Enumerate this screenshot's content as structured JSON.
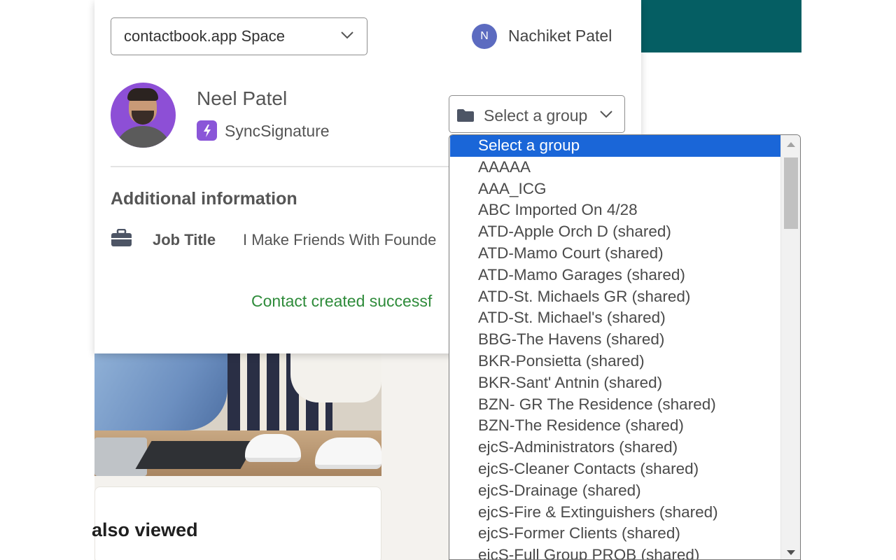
{
  "header": {
    "space_select_label": "contactbook.app Space",
    "user_initial": "N",
    "user_name": "Nachiket Patel"
  },
  "contact": {
    "name": "Neel Patel",
    "company": "SyncSignature"
  },
  "group_select": {
    "label": "Select a group"
  },
  "additional_info": {
    "title": "Additional information",
    "job_title_label": "Job Title",
    "job_title_value": "I Make Friends With Founde"
  },
  "status": {
    "message": "Contact created successf"
  },
  "background": {
    "also_viewed_title": "also viewed"
  },
  "group_options": [
    "Select a group",
    "AAAAA",
    "AAA_ICG",
    "ABC Imported On 4/28",
    "ATD-Apple Orch D (shared)",
    "ATD-Mamo Court (shared)",
    "ATD-Mamo Garages (shared)",
    "ATD-St. Michaels GR (shared)",
    "ATD-St. Michael's (shared)",
    "BBG-The Havens (shared)",
    "BKR-Ponsietta (shared)",
    "BKR-Sant' Antnin (shared)",
    "BZN- GR The Residence (shared)",
    "BZN-The Residence (shared)",
    "ejcS-Administrators (shared)",
    "ejcS-Cleaner Contacts (shared)",
    "ejcS-Drainage (shared)",
    "ejcS-Fire & Extinguishers (shared)",
    "ejcS-Former Clients (shared)",
    "ejcS-Full Group PROB (shared)"
  ],
  "selected_option_index": 0,
  "colors": {
    "accent_selected": "#1a66d8",
    "teal_header": "#055e63",
    "success_green": "#2e8b3a",
    "avatar_purple": "#8d4fd6",
    "user_avatar_blue": "#5c6bc0"
  },
  "icons": [
    "chevron-down-icon",
    "folder-icon",
    "briefcase-icon",
    "lightning-icon",
    "scroll-up-arrow-icon",
    "scroll-down-arrow-icon"
  ]
}
